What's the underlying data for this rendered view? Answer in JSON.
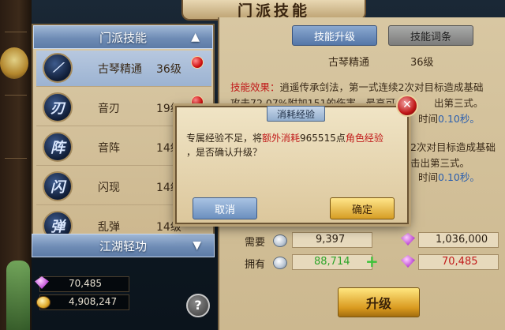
{
  "title": "门派技能",
  "left_panel": {
    "header": "门派技能",
    "skills": [
      {
        "icon": "",
        "name": "古琴精通",
        "level": "36级",
        "selected": true
      },
      {
        "icon": "刃",
        "name": "音刃",
        "level": "19级",
        "selected": false
      },
      {
        "icon": "阵",
        "name": "音阵",
        "level": "14级",
        "selected": false
      },
      {
        "icon": "闪",
        "name": "闪现",
        "level": "14级",
        "selected": false
      },
      {
        "icon": "弹",
        "name": "乱弹",
        "level": "14级",
        "selected": false
      }
    ],
    "section2_header": "江湖轻功"
  },
  "currency": {
    "gem_value": "70,485",
    "coin_value": "4,908,247"
  },
  "help_label": "?",
  "tabs": {
    "upgrade": "技能升级",
    "words": "技能词条"
  },
  "detail": {
    "name": "古琴精通",
    "level": "36级",
    "line1_prefix": "技能效果：",
    "line1_text": "逍遥传承剑法，第一式连续2次对目标造成基础",
    "line2_text": "攻击72.07%附加151的伤害，最高可",
    "line2_tail": "出第三式。",
    "line3_time": "0.10秒。",
    "line3_prefix": "时间",
    "line4_text": "2次对目标造成基础",
    "line5_tail": "击出第三式。",
    "line6_prefix": "时间",
    "line6_time": "0.10秒。"
  },
  "cost": {
    "need_label": "需要",
    "have_label": "拥有",
    "need_coin": "9,397",
    "need_gem": "1,036,000",
    "have_coin": "88,714",
    "have_gem": "70,485"
  },
  "upgrade_button": "升级",
  "dialog": {
    "title": "消耗经验",
    "msg_part1": "专属经验不足，将",
    "msg_red1": "额外消耗",
    "msg_num": "965515点",
    "msg_red2": "角色经验",
    "msg_line2": "，是否确认升级？",
    "cancel": "取消",
    "confirm": "确定"
  },
  "colors": {
    "accent_blue": "#6f8cb5",
    "warning_red": "#c11a1a",
    "gold": "#d99a1f",
    "green": "#3dc23a"
  }
}
